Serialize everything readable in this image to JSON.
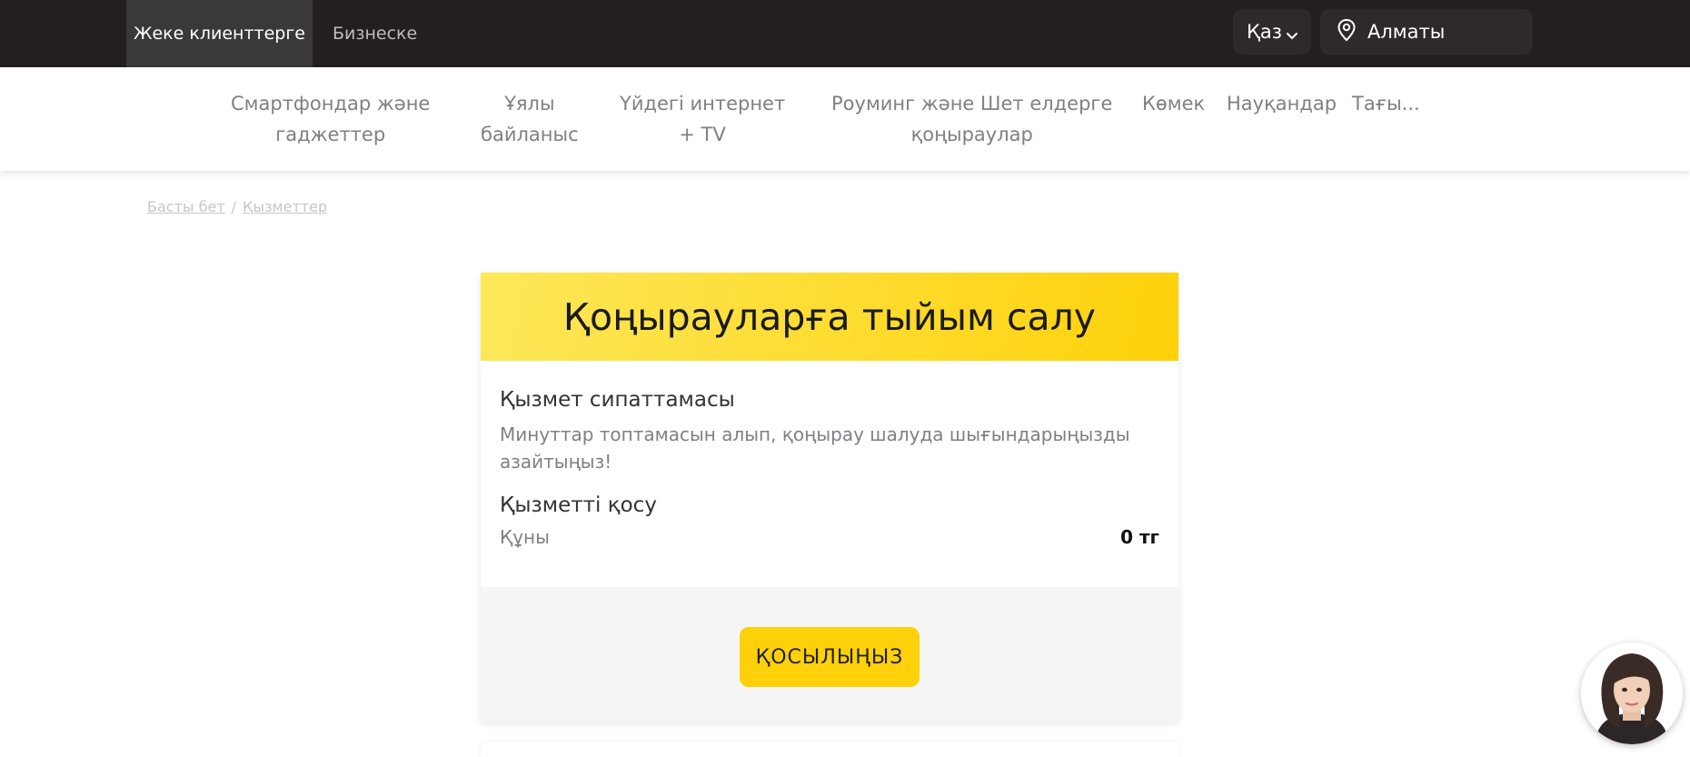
{
  "topbar": {
    "segment_active": "Жеке клиенттерге",
    "segment_other": "Бизнеске",
    "language": "Қаз",
    "city": "Алматы"
  },
  "nav": {
    "items": [
      {
        "line1": "Смартфондар және",
        "line2": "гаджеттер"
      },
      {
        "line1": "Ұялы",
        "line2": "байланыс"
      },
      {
        "line1": "Үйдегі интернет",
        "line2": "+ TV"
      },
      {
        "line1": "Роуминг және Шет елдерге",
        "line2": "қоңыраулар"
      },
      {
        "line1": "Көмек",
        "line2": ""
      },
      {
        "line1": "Науқандар",
        "line2": ""
      },
      {
        "line1": "Тағы...",
        "line2": ""
      }
    ]
  },
  "breadcrumb": {
    "home": "Басты бет",
    "separator": "/",
    "services": "Қызметтер"
  },
  "service": {
    "title": "Қоңырауларға тыйым салу",
    "description_heading": "Қызмет сипаттамасы",
    "description": "Минуттар топтамасын алып, қоңырау шалуда шығындарыңызды азайтыңыз!",
    "enable_heading": "Қызметті қосу",
    "price_label": "Құны",
    "price_value": "0 тг",
    "cta_label": "ҚОСЫЛЫҢЫЗ"
  },
  "colors": {
    "topbar_bg": "#231f20",
    "accent_yellow": "#fed10a",
    "nav_text": "#7d8185"
  },
  "icons": {
    "language_dropdown": "chevron-down-icon",
    "city": "location-pin-icon",
    "assistant": "assistant-avatar"
  }
}
